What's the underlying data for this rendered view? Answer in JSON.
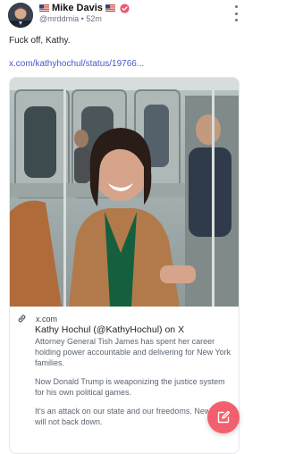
{
  "post": {
    "author_name": "Mike Davis",
    "handle": "@mrddmia",
    "separator": "•",
    "time_ago": "52m",
    "text": "Fuck off, Kathy.",
    "link_text": "x.com/kathyhochul/status/19766..."
  },
  "embed": {
    "domain": "x.com",
    "title": "Kathy Hochul (@KathyHochul) on X",
    "description": [
      "Attorney General Tish James has spent her career holding power accountable and delivering for New York families.",
      "Now Donald Trump is weaponizing the justice system for his own political games.",
      "It's an attack on our state and our freedoms. New York will not back down."
    ]
  },
  "icons": {
    "author_flags": "us-flag-icon",
    "verified": "verified-badge-icon",
    "more": "more-options-icon",
    "link": "link-icon",
    "compose": "compose-icon"
  },
  "colors": {
    "link": "#4a57c8",
    "verified_badge": "#e85d75",
    "compose_button": "#f2606d",
    "muted_text": "#6b7280"
  }
}
